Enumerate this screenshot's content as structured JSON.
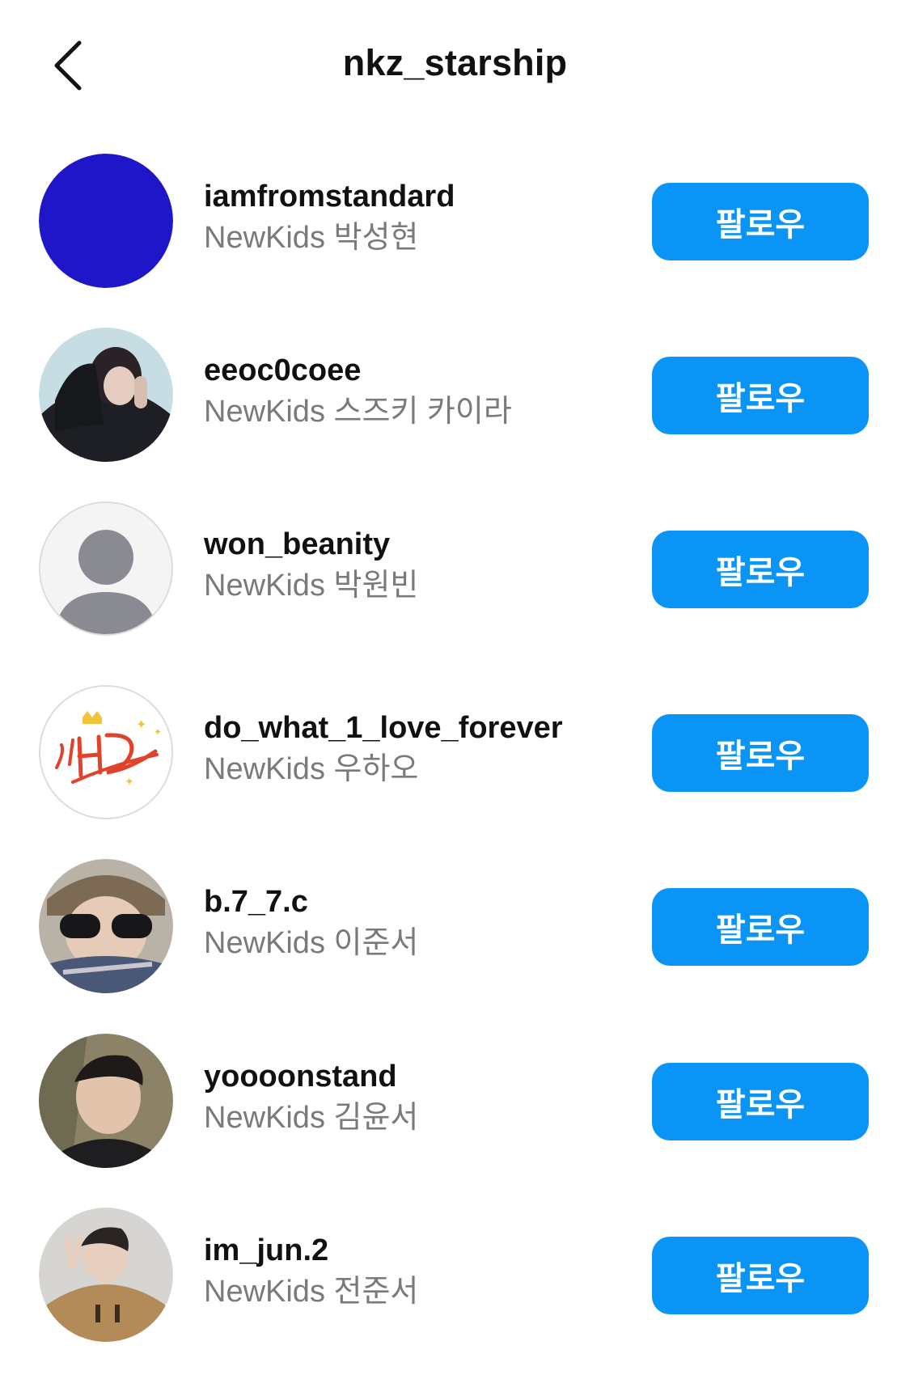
{
  "header": {
    "title": "nkz_starship",
    "back_icon": "chevron-left-icon"
  },
  "accounts": [
    {
      "username": "iamfromstandard",
      "full_name": "NewKids 박성현",
      "button_label": "팔로우",
      "avatar": "solid-blue-avatar"
    },
    {
      "username": "eeoc0coee",
      "full_name": "NewKids 스즈키 카이라",
      "button_label": "팔로우",
      "avatar": "photo-avatar"
    },
    {
      "username": "won_beanity",
      "full_name": "NewKids 박원빈",
      "button_label": "팔로우",
      "avatar": "default-person-avatar"
    },
    {
      "username": "do_what_1_love_forever",
      "full_name": "NewKids 우하오",
      "button_label": "팔로우",
      "avatar": "doodle-avatar"
    },
    {
      "username": "b.7_7.c",
      "full_name": "NewKids 이준서",
      "button_label": "팔로우",
      "avatar": "photo-avatar"
    },
    {
      "username": "yoooonstand",
      "full_name": "NewKids 김윤서",
      "button_label": "팔로우",
      "avatar": "photo-avatar"
    },
    {
      "username": "im_jun.2",
      "full_name": "NewKids 전준서",
      "button_label": "팔로우",
      "avatar": "photo-avatar"
    }
  ],
  "colors": {
    "follow_button": "#0a95f6",
    "secondary_text": "#7a7a7a",
    "avatar_blue": "#1f16c9"
  }
}
